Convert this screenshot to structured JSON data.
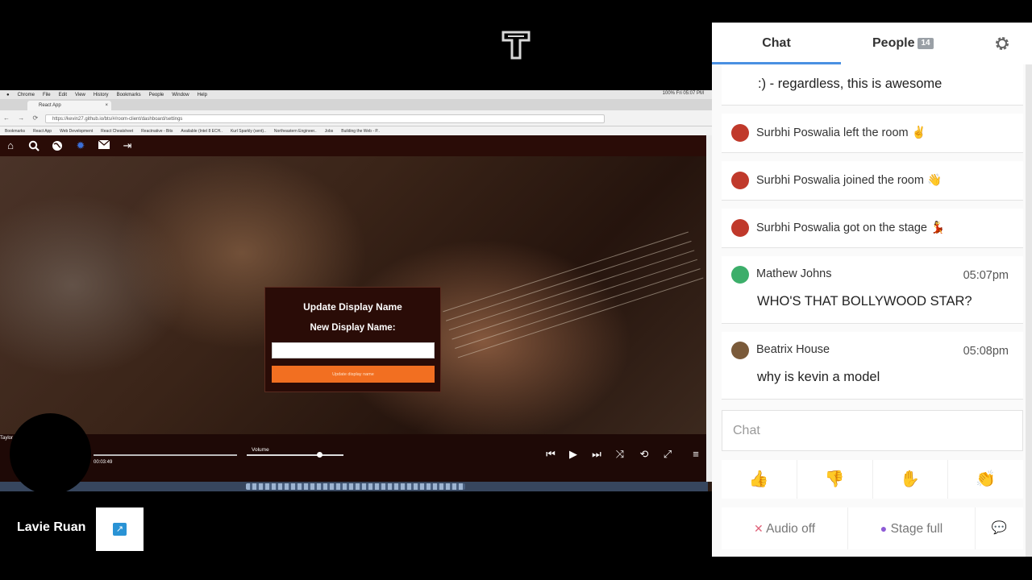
{
  "app": {
    "accent": "#4a90e2",
    "logo_icon": "t-logo-icon"
  },
  "screen_share": {
    "mac_menu": [
      "Chrome",
      "File",
      "Edit",
      "View",
      "History",
      "Bookmarks",
      "People",
      "Window",
      "Help"
    ],
    "mac_status_right": "100%  Fri 05:07 PM",
    "browser_tab_title": "React App",
    "address_url": "https://kevin27.github.io/bts/#/room-client/dashboard/settings",
    "bookmarks": [
      "Bookmarks",
      "React App",
      "Web Development",
      "React Cheatsheet",
      "Reactnative - Bits",
      "Available (Intel 8 ECH..",
      "Kurl Sparkly (sent)..",
      "Northeastern Engineer..",
      "Jobs",
      "Building the Web - P.."
    ],
    "nav_icons": [
      "home-icon",
      "search-icon",
      "globe-icon",
      "settings-icon",
      "mail-icon",
      "logout-icon"
    ],
    "dialog": {
      "title": "Update Display Name",
      "label": "New Display Name:",
      "input_value": "",
      "button_label": "Update display name"
    },
    "player": {
      "track_owner": "Taylor",
      "elapsed": "00:03:49",
      "volume_label": "Volume",
      "volume_level": 0.75,
      "controls": [
        "previous-icon",
        "play-icon",
        "next-icon",
        "shuffle-icon",
        "repeat-icon",
        "fullscreen-icon",
        "menu-icon"
      ]
    }
  },
  "user": {
    "name": "Lavie Ruan"
  },
  "chat_panel": {
    "tab_chat": "Chat",
    "tab_people": "People",
    "people_count": "14",
    "messages": [
      {
        "type": "text-continued",
        "text": ":) - regardless, this is awesome"
      },
      {
        "type": "system",
        "name": "Surbhi Poswalia",
        "text": "Surbhi Poswalia left the room",
        "emoji": "✌"
      },
      {
        "type": "system",
        "name": "Surbhi Poswalia",
        "text": "Surbhi Poswalia joined the room",
        "emoji": "👋"
      },
      {
        "type": "system",
        "name": "Surbhi Poswalia",
        "text": "Surbhi Poswalia got on the stage",
        "emoji": "💃"
      },
      {
        "type": "message",
        "name": "Mathew Johns",
        "time": "05:07pm",
        "text": "WHO'S THAT BOLLYWOOD STAR?"
      },
      {
        "type": "message",
        "name": "Beatrix House",
        "time": "05:08pm",
        "text": "why is kevin a model"
      }
    ],
    "input_placeholder": "Chat",
    "reactions": [
      "👍",
      "👎",
      "✋",
      "👏"
    ],
    "audio_label": "Audio off",
    "stage_label": "Stage full"
  }
}
